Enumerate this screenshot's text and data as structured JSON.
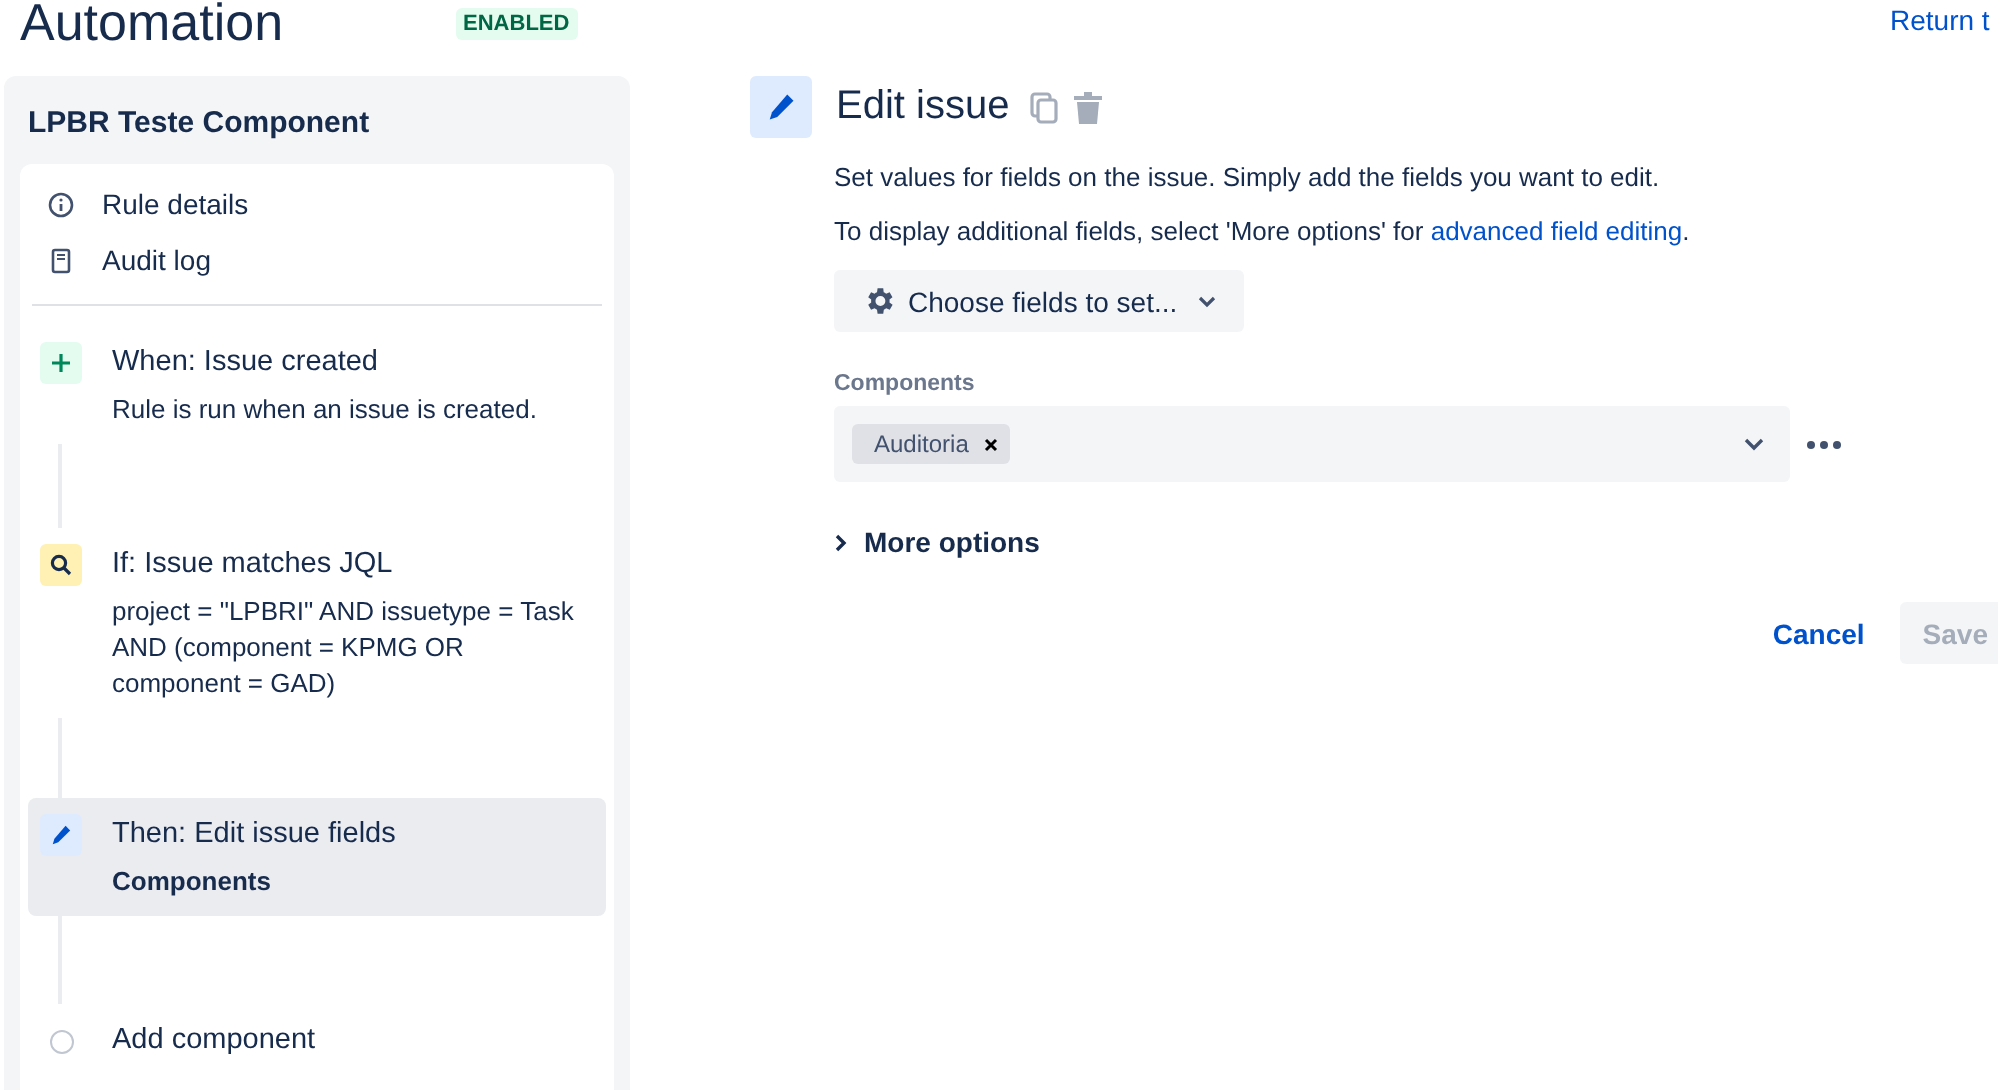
{
  "header": {
    "title": "Automation",
    "status": "ENABLED",
    "return_link": "Return t"
  },
  "sidebar": {
    "rule_name": "LPBR Teste Component",
    "nav": [
      {
        "kind": "info",
        "label": "Rule details"
      },
      {
        "kind": "log",
        "label": "Audit log"
      }
    ],
    "steps": [
      {
        "kind": "trigger",
        "title": "When: Issue created",
        "detail": "Rule is run when an issue is created.",
        "selected": false
      },
      {
        "kind": "condition",
        "title": "If: Issue matches JQL",
        "detail": "project = \"LPBRI\" AND issuetype = Task AND (component = KPMG OR component = GAD)",
        "selected": false
      },
      {
        "kind": "action",
        "title": "Then: Edit issue fields",
        "detail": "Components",
        "selected": true
      },
      {
        "kind": "add",
        "title": "Add component",
        "selected": false
      }
    ]
  },
  "editor": {
    "title": "Edit issue",
    "description": "Set values for fields on the issue. Simply add the fields you want to edit.",
    "hint": "To display additional fields, select 'More options' for ",
    "hint_link": "advanced field editing",
    "hint_end": ".",
    "choose_button": "Choose fields to set...",
    "field": {
      "label": "Components",
      "tags": [
        "Auditoria"
      ]
    },
    "more_options": {
      "label": "More options",
      "expanded": false
    },
    "buttons": {
      "cancel": "Cancel",
      "save": "Save"
    }
  }
}
